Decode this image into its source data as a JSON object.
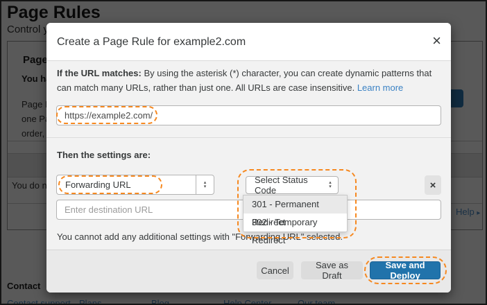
{
  "background": {
    "title": "Page Rules",
    "subtitle_fragment": "Control y",
    "card": {
      "header_fragment": "Page",
      "note_fragment": "You ha",
      "paragraph_lines": {
        "0": "Page R",
        "1": "one Pa",
        "2": "order,"
      },
      "empty_state_fragment": "You do no",
      "help_link": "Help",
      "help_arrow": "▸"
    },
    "footer": {
      "heading": "Contact",
      "links": {
        "0": "Contact support",
        "1": "Plans",
        "2": "Blog",
        "3": "Help Center",
        "4": "Our team"
      }
    }
  },
  "modal": {
    "title": "Create a Page Rule for example2.com",
    "close_glyph": "×",
    "description": {
      "bold_lead": "If the URL matches:",
      "body": " By using the asterisk (*) character, you can create dynamic patterns that can match many URLs, rather than just one. All URLs are case insensitive. ",
      "link_label": "Learn more"
    },
    "url_input": {
      "value": "https://example2.com/"
    },
    "settings_heading": "Then the settings are:",
    "setting_select": {
      "value": "Forwarding URL",
      "up_glyph": "▴",
      "down_glyph": "▾"
    },
    "status_select": {
      "value": "Select Status Code",
      "up_glyph": "▴",
      "down_glyph": "▾",
      "options": {
        "0": "301 - Permanent Redirect",
        "1": "302 - Temporary Redirect"
      }
    },
    "remove_glyph": "×",
    "destination_input": {
      "placeholder": "Enter destination URL"
    },
    "note": "You cannot add any additional settings with \"Forwarding URL\" selected.",
    "buttons": {
      "cancel": "Cancel",
      "save_draft": "Save as Draft",
      "save_deploy": "Save and Deploy"
    }
  },
  "colors": {
    "annotation_orange": "#f6881f",
    "primary_blue": "#2173ab",
    "link_blue": "#3b82c4",
    "modal_body_gray": "#f2f2f2"
  }
}
